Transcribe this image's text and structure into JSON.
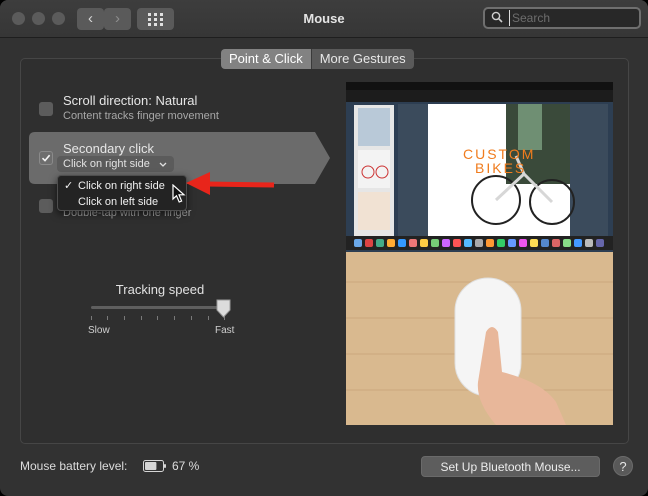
{
  "window": {
    "title": "Mouse"
  },
  "search": {
    "placeholder": "Search"
  },
  "tabs": [
    {
      "label": "Point & Click",
      "active": true
    },
    {
      "label": "More Gestures",
      "active": false
    }
  ],
  "options": {
    "scroll": {
      "title": "Scroll direction: Natural",
      "subtitle": "Content tracks finger movement",
      "checked": false
    },
    "secondary": {
      "title": "Secondary click",
      "selected": "Click on right side",
      "checked": true
    },
    "smart_zoom": {
      "subtitle": "Double-tap with one finger",
      "checked": false
    }
  },
  "dropdown_menu": {
    "items": [
      {
        "label": "Click on right side",
        "checked": true
      },
      {
        "label": "Click on left side",
        "checked": false
      }
    ]
  },
  "tracking": {
    "label": "Tracking speed",
    "min_label": "Slow",
    "max_label": "Fast",
    "value_fraction": 1.0
  },
  "preview": {
    "doc_title_1": "CUSTOM",
    "doc_title_2": "BIKES"
  },
  "footer": {
    "battery_label": "Mouse battery level:",
    "battery_percent": "67 %",
    "battery_fraction": 0.67,
    "bluetooth_button": "Set Up Bluetooth Mouse...",
    "help_label": "?"
  },
  "colors": {
    "annotation_arrow": "#e8251b",
    "accent_orange": "#f07c1e"
  },
  "icons": [
    "search-icon",
    "back-icon",
    "forward-icon",
    "grid-icon",
    "checkmark-icon",
    "chevron-down-icon",
    "cursor-icon",
    "battery-icon",
    "help-icon"
  ]
}
